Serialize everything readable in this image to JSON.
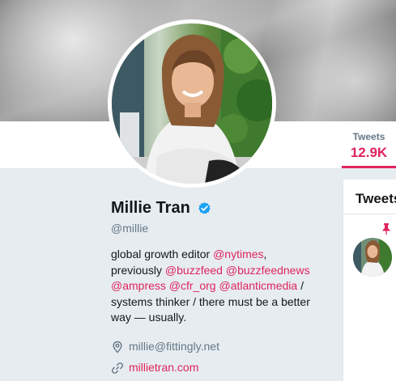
{
  "nav": {
    "tweets_label": "Tweets",
    "tweets_count": "12.9K"
  },
  "profile": {
    "name": "Millie Tran",
    "screen_name": "@millie",
    "verified_icon": "verified-badge-icon",
    "bio": {
      "t1": "global growth editor ",
      "m1": "@nytimes",
      "t2": ",",
      "t3": "previously ",
      "m2": "@buzzfeed",
      "t4": " ",
      "m3": "@buzzfeednews",
      "m4": "@ampress",
      "t5": " ",
      "m5": "@cfr_org",
      "t6": " ",
      "m6": "@atlanticmedia",
      "t7": " /",
      "t8": "systems thinker / there must be a better",
      "t9": "way — usually."
    },
    "location_icon": "location-pin-icon",
    "location": "millie@fittingly.net",
    "link_icon": "link-icon",
    "website": "millietran.com"
  },
  "timeline": {
    "title": "Tweets",
    "pin_icon": "pin-icon"
  },
  "colors": {
    "accent": "#e0245e",
    "verified": "#1da1f2",
    "background": "#e6ecf0"
  }
}
